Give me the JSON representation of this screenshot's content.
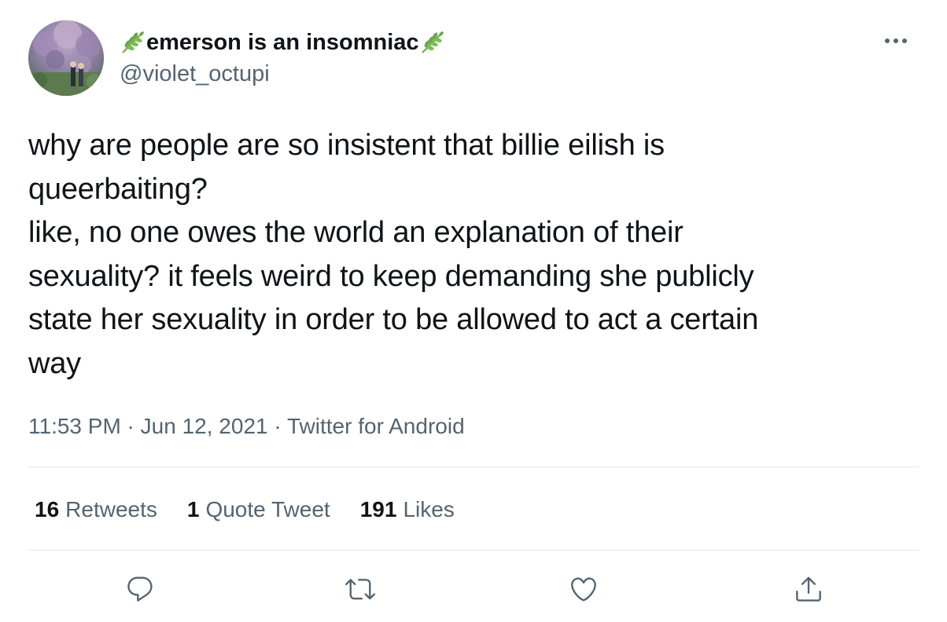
{
  "author": {
    "display_name": "emerson is an insomniac",
    "handle": "@violet_octupi",
    "display_name_emoji": "herb"
  },
  "tweet": {
    "text_lines": [
      "why are people are so insistent that billie eilish is",
      "queerbaiting?",
      "like, no one owes the world an explanation of their",
      "sexuality? it feels weird to keep demanding she publicly",
      "state her sexuality in order to be allowed to act a certain",
      "way"
    ],
    "time": "11:53 PM",
    "date": "Jun 12, 2021",
    "source": "Twitter for Android",
    "separator": " · "
  },
  "stats": {
    "retweets": {
      "count": "16",
      "label": "Retweets"
    },
    "quotes": {
      "count": "1",
      "label": "Quote Tweet"
    },
    "likes": {
      "count": "191",
      "label": "Likes"
    }
  },
  "icons": {
    "more": "more-icon",
    "reply": "reply-icon",
    "retweet": "retweet-icon",
    "like": "heart-icon",
    "share": "share-icon"
  },
  "colors": {
    "text": "#0f1419",
    "secondary": "#536471",
    "divider": "#e1e8ed",
    "icon": "#536471"
  }
}
